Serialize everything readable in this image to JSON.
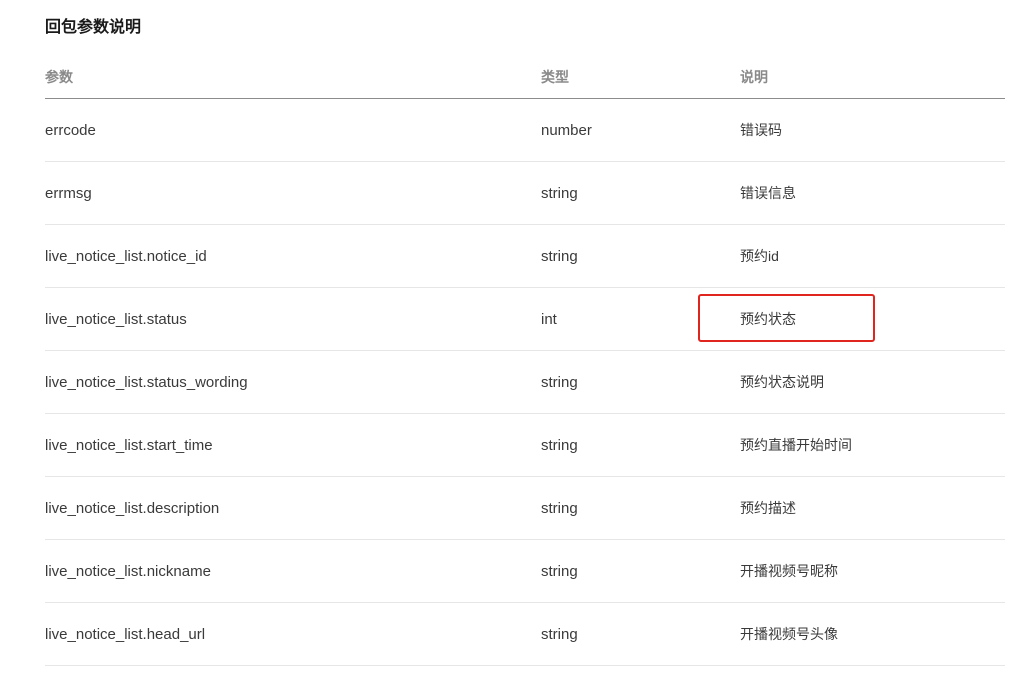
{
  "section": {
    "title": "回包参数说明"
  },
  "table": {
    "headers": {
      "param": "参数",
      "type": "类型",
      "desc": "说明"
    },
    "rows": [
      {
        "param": "errcode",
        "type": "number",
        "desc": "错误码"
      },
      {
        "param": "errmsg",
        "type": "string",
        "desc": "错误信息"
      },
      {
        "param": "live_notice_list.notice_id",
        "type": "string",
        "desc": "预约id"
      },
      {
        "param": "live_notice_list.status",
        "type": "int",
        "desc": "预约状态"
      },
      {
        "param": "live_notice_list.status_wording",
        "type": "string",
        "desc": "预约状态说明"
      },
      {
        "param": "live_notice_list.start_time",
        "type": "string",
        "desc": "预约直播开始时间"
      },
      {
        "param": "live_notice_list.description",
        "type": "string",
        "desc": "预约描述"
      },
      {
        "param": "live_notice_list.nickname",
        "type": "string",
        "desc": "开播视频号昵称"
      },
      {
        "param": "live_notice_list.head_url",
        "type": "string",
        "desc": "开播视频号头像"
      }
    ]
  },
  "annotation": {
    "color": "#e0241e",
    "target_row": 3
  }
}
